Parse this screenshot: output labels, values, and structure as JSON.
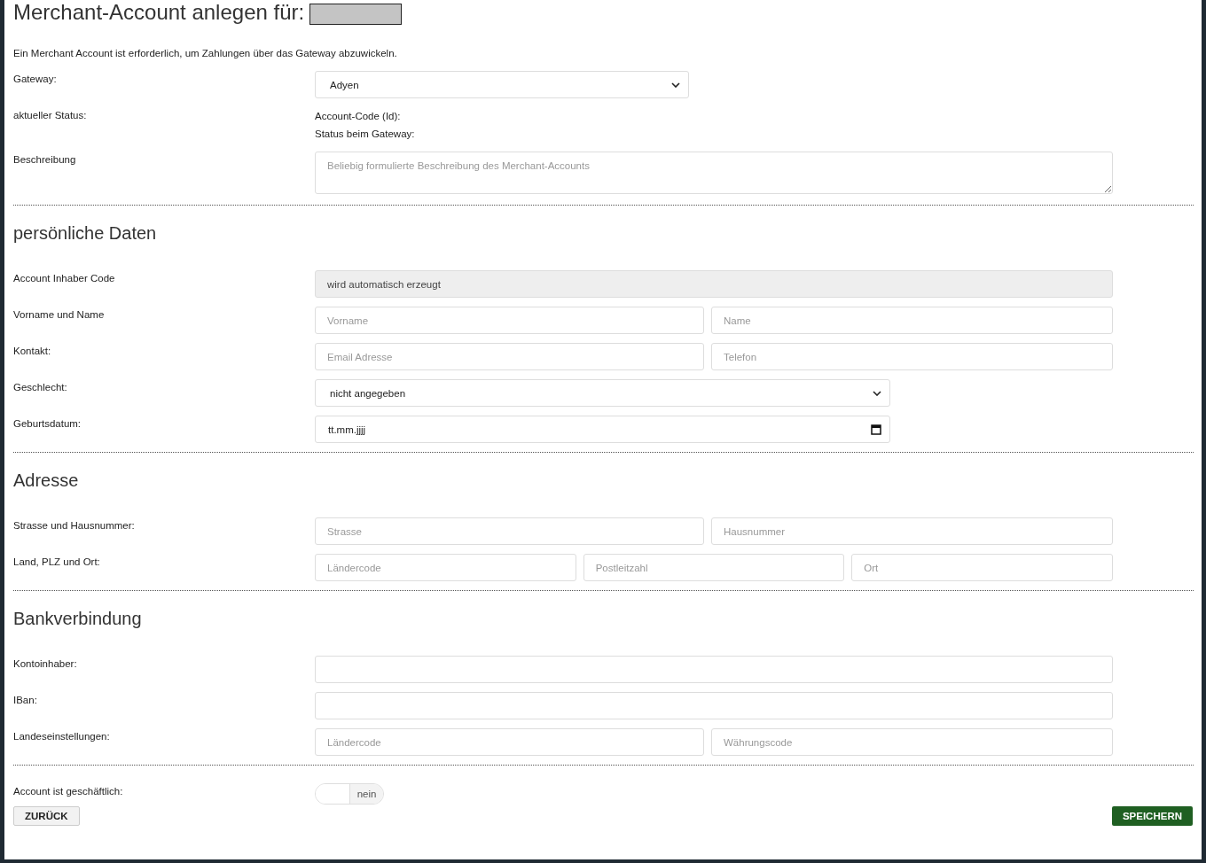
{
  "title": "Merchant-Account anlegen für:",
  "intro": "Ein Merchant Account ist erforderlich, um Zahlungen über das Gateway abzuwickeln.",
  "header_rows": [
    {
      "kind": "select",
      "label": "Gateway:",
      "value": "Adyen"
    },
    {
      "kind": "info",
      "label": "aktueller Status:",
      "lines": [
        "Account-Code (Id):",
        "Status beim Gateway:"
      ]
    },
    {
      "kind": "textarea",
      "label": "Beschreibung",
      "placeholder": "Beliebig formulierte Beschreibung des Merchant-Accounts"
    }
  ],
  "sections": [
    {
      "heading": "persönliche Daten",
      "rows": [
        {
          "kind": "inputs",
          "label": "Account Inhaber Code",
          "inputs": [
            {
              "value": "wird automatisch erzeugt",
              "disabled": true
            }
          ]
        },
        {
          "kind": "inputs",
          "label": "Vorname und Name",
          "inputs": [
            {
              "placeholder": "Vorname",
              "disabled": false
            },
            {
              "placeholder": "Name",
              "disabled": false
            }
          ]
        },
        {
          "kind": "inputs",
          "label": "Kontakt:",
          "inputs": [
            {
              "placeholder": "Email Adresse",
              "disabled": false
            },
            {
              "placeholder": "Telefon",
              "disabled": false
            }
          ]
        },
        {
          "kind": "select",
          "label": "Geschlecht:",
          "value": "nicht angegeben"
        },
        {
          "kind": "date",
          "label": "Geburtsdatum:",
          "value": "tt.mm.jjjj"
        }
      ]
    },
    {
      "heading": "Adresse",
      "rows": [
        {
          "kind": "inputs",
          "label": "Strasse und Hausnummer:",
          "inputs": [
            {
              "placeholder": "Strasse",
              "disabled": false
            },
            {
              "placeholder": "Hausnummer",
              "disabled": false
            }
          ]
        },
        {
          "kind": "inputs",
          "label": "Land, PLZ und Ort:",
          "inputs": [
            {
              "placeholder": "Ländercode",
              "disabled": false
            },
            {
              "placeholder": "Postleitzahl",
              "disabled": false
            },
            {
              "placeholder": "Ort",
              "disabled": false
            }
          ]
        }
      ]
    },
    {
      "heading": "Bankverbindung",
      "rows": [
        {
          "kind": "inputs",
          "label": "Kontoinhaber:",
          "inputs": [
            {
              "disabled": false
            }
          ]
        },
        {
          "kind": "inputs",
          "label": "IBan:",
          "inputs": [
            {
              "disabled": false
            }
          ]
        },
        {
          "kind": "inputs",
          "label": "Landeseinstellungen:",
          "inputs": [
            {
              "placeholder": "Ländercode",
              "disabled": false
            },
            {
              "placeholder": "Währungscode",
              "disabled": false
            }
          ]
        }
      ]
    }
  ],
  "business": {
    "label": "Account ist geschäftlich:",
    "on": false,
    "state_label": "nein"
  },
  "buttons": {
    "back": "ZURÜCK",
    "save": "SPEICHERN"
  }
}
